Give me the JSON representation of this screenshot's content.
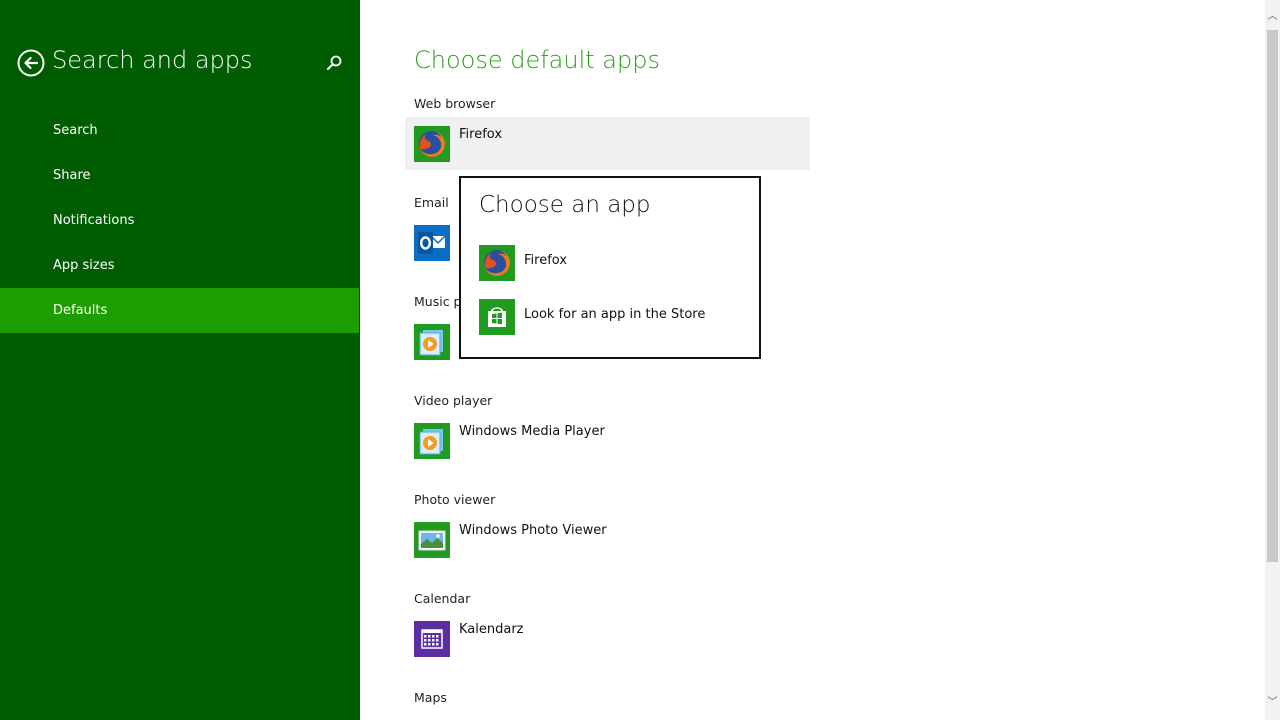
{
  "sidebar": {
    "title": "Search and apps",
    "items": [
      {
        "label": "Search"
      },
      {
        "label": "Share"
      },
      {
        "label": "Notifications"
      },
      {
        "label": "App sizes"
      },
      {
        "label": "Defaults"
      }
    ],
    "active_index": 4,
    "bg_color": "#005c00",
    "active_color": "#1c9e00"
  },
  "main": {
    "title": "Choose default apps",
    "title_color": "#2b9e1a",
    "sections": [
      {
        "label": "Web browser",
        "app": "Firefox",
        "icon": "firefox-icon"
      },
      {
        "label": "Email",
        "app": "",
        "icon": "outlook-icon"
      },
      {
        "label": "Music p",
        "app": "",
        "icon": "media-player-icon"
      },
      {
        "label": "Video player",
        "app": "Windows Media Player",
        "icon": "media-player-icon"
      },
      {
        "label": "Photo viewer",
        "app": "Windows Photo Viewer",
        "icon": "photo-viewer-icon"
      },
      {
        "label": "Calendar",
        "app": "Kalendarz",
        "icon": "calendar-icon"
      },
      {
        "label": "Maps",
        "app": "",
        "icon": ""
      }
    ]
  },
  "flyout": {
    "title": "Choose an app",
    "items": [
      {
        "label": "Firefox",
        "icon": "firefox-icon"
      },
      {
        "label": "Look for an app in the Store",
        "icon": "store-icon"
      }
    ]
  },
  "scrollbar": {
    "up_glyph": "︿",
    "down_glyph": "﹀"
  }
}
